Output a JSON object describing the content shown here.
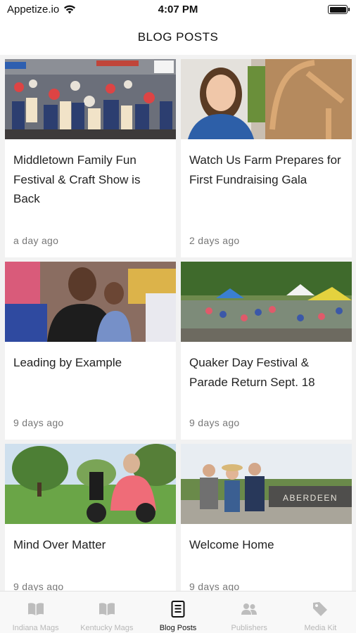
{
  "status_bar": {
    "carrier": "Appetize.io",
    "time": "4:07 PM"
  },
  "header": {
    "title": "BLOG POSTS"
  },
  "posts": [
    {
      "title": "Middletown Family Fun Festival & Craft Show is Back",
      "time": "a day ago",
      "image": "festival-crowd-photo"
    },
    {
      "title": "Watch Us Farm Prepares for First Fundraising Gala",
      "time": "2 days ago",
      "image": "woman-portrait-photo"
    },
    {
      "title": "Leading by Example",
      "time": "9 days ago",
      "image": "father-daughter-photo"
    },
    {
      "title": "Quaker Day Festival & Parade Return Sept. 18",
      "time": "9 days ago",
      "image": "parade-tents-photo"
    },
    {
      "title": "Mind Over Matter",
      "time": "9 days ago",
      "image": "wheelchair-park-photo"
    },
    {
      "title": "Welcome Home",
      "time": "9 days ago",
      "image": "aberdeen-sign-photo",
      "sign_text": "ABERDEEN"
    }
  ],
  "tabs": [
    {
      "label": "Indiana Mags",
      "icon": "open-book-icon",
      "active": false
    },
    {
      "label": "Kentucky Mags",
      "icon": "open-book-icon",
      "active": false
    },
    {
      "label": "Blog Posts",
      "icon": "document-icon",
      "active": true
    },
    {
      "label": "Publishers",
      "icon": "people-icon",
      "active": false
    },
    {
      "label": "Media Kit",
      "icon": "tag-icon",
      "active": false
    }
  ],
  "colors": {
    "background": "#f2f2f2",
    "card": "#ffffff",
    "active_tab": "#111111",
    "inactive_tab": "#b8b8b8"
  }
}
